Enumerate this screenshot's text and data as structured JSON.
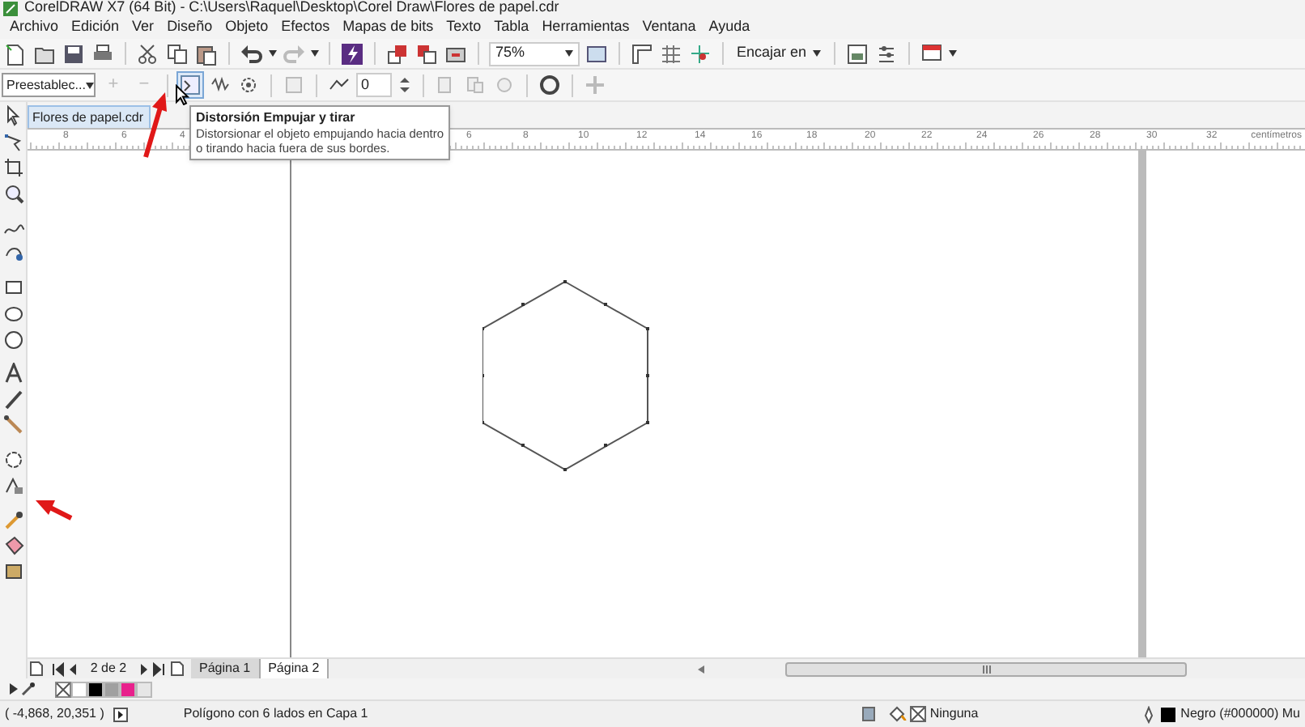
{
  "window": {
    "title": "CorelDRAW X7 (64 Bit) - C:\\Users\\Raquel\\Desktop\\Corel Draw\\Flores de papel.cdr"
  },
  "menu": [
    "Archivo",
    "Edición",
    "Ver",
    "Diseño",
    "Objeto",
    "Efectos",
    "Mapas de bits",
    "Texto",
    "Tabla",
    "Herramientas",
    "Ventana",
    "Ayuda"
  ],
  "standard_toolbar": {
    "zoom": "75%",
    "snap": "Encajar en"
  },
  "property_bar": {
    "preset": "Preestablec...",
    "add": "+",
    "remove": "−",
    "amplitude": "0"
  },
  "tooltip": {
    "title": "Distorsión Empujar y tirar",
    "text": "Distorsionar el objeto empujando hacia dentro o tirando hacia fuera de sus bordes."
  },
  "document_tabs": [
    {
      "label": "Flores de papel.cdr",
      "selected": true
    }
  ],
  "ruler": {
    "labels": [
      "8",
      "6",
      "4",
      "6",
      "8",
      "10",
      "12",
      "14",
      "16",
      "18",
      "20",
      "22",
      "24",
      "26",
      "28",
      "30",
      "32"
    ],
    "unit": "centímetros"
  },
  "page_nav": {
    "counter": "2 de 2",
    "pages": [
      {
        "label": "Página 1",
        "selected": false
      },
      {
        "label": "Página 2",
        "selected": true
      }
    ]
  },
  "palette": [
    {
      "color": "#ffffff"
    },
    {
      "color": "#000000"
    },
    {
      "color": "#a0a0a0"
    },
    {
      "color": "#e8218c"
    },
    {
      "color": "#e6e6e6"
    }
  ],
  "status_bar": {
    "coordinates": "( -4,868, 20,351 )",
    "object_info": "Polígono con 6 lados en Capa 1",
    "fill": "Ninguna",
    "outline": "Negro (#000000) Mu"
  }
}
